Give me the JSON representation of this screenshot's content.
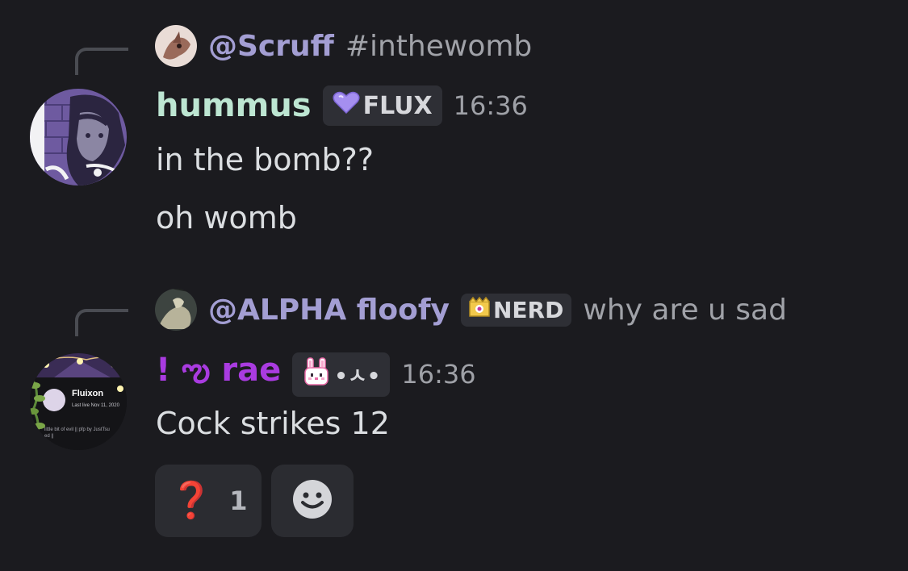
{
  "messages": [
    {
      "reply": {
        "author": "@Scruff",
        "text": "#inthewomb"
      },
      "author": "hummus",
      "author_color": "#bde6d2",
      "tag": {
        "icon": "purple-heart-icon",
        "label": "FLUX"
      },
      "time": "16:36",
      "lines": [
        "in the bomb??",
        "oh womb"
      ]
    },
    {
      "reply": {
        "author": "@ALPHA floofy",
        "tag": {
          "icon": "crown-icon",
          "label": "NERD"
        },
        "text": "why are u sad"
      },
      "author": "! ఌ rae",
      "author_color": "#a93be0",
      "tag": {
        "icon": "bunny-icon",
        "label": "•ㅅ•"
      },
      "time": "16:36",
      "lines": [
        "Cock strikes 12"
      ],
      "avatar_card": {
        "name": "Fluixon",
        "last_live": "Last live Nov 11, 2020",
        "bio": "little bit of evil || pfp by JustTsu",
        "bio_tail": "ed ||"
      },
      "reactions": [
        {
          "icon": "question-mark-icon",
          "emoji": "❓",
          "count": "1"
        }
      ],
      "add_reaction_icon": "smiley-icon"
    }
  ]
}
